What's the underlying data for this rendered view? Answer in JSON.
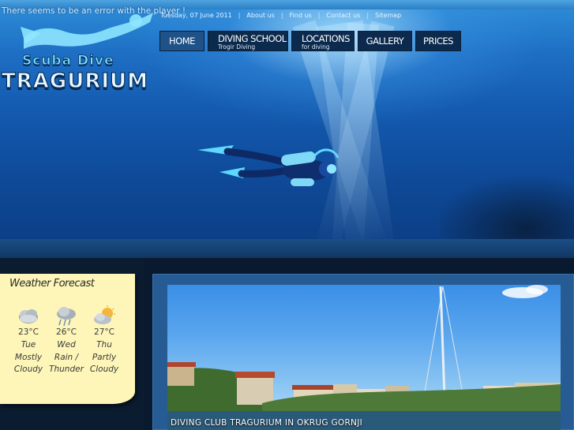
{
  "player": {
    "error_text": "There seems to be an error with the player !"
  },
  "meta": {
    "date": "Tuesday, 07 June 2011",
    "links": [
      "About us",
      "Find us",
      "Contact us",
      "Sitemap"
    ]
  },
  "logo": {
    "line1": "Scuba Dive",
    "line2": "TRAGURIUM"
  },
  "nav": {
    "home": "HOME",
    "diving_school": {
      "main": "DIVING SCHOOL",
      "sub": "Trogir Diving"
    },
    "locations": {
      "main": "LOCATIONS",
      "sub": "for diving"
    },
    "gallery": "GALLERY",
    "prices": "PRICES"
  },
  "weather": {
    "title": "Weather Forecast",
    "days": [
      {
        "temp": "23°C",
        "day": "Tue",
        "cond1": "Mostly",
        "cond2": "Cloudy",
        "icon": "cloud-icon"
      },
      {
        "temp": "26°C",
        "day": "Wed",
        "cond1": "Rain /",
        "cond2": "Thunder",
        "icon": "thunderstorm-icon"
      },
      {
        "temp": "27°C",
        "day": "Thu",
        "cond1": "Partly",
        "cond2": "Cloudy",
        "icon": "partly-cloudy-icon"
      }
    ]
  },
  "photo": {
    "caption": "DIVING CLUB TRAGURIUM IN OKRUG GORNJI"
  },
  "colors": {
    "accent": "#1e5288",
    "nav_bg": "#0b2a4d",
    "note_bg": "#fdf6b8"
  }
}
